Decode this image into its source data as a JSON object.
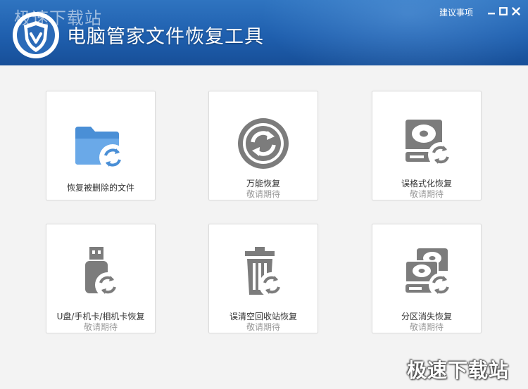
{
  "window": {
    "title": "电脑管家文件恢复工具",
    "watermark_top": "极速下载站",
    "suggestion_link": "建议事项",
    "controls": [
      "minimize-icon",
      "maximize-icon",
      "close-icon"
    ]
  },
  "colors": {
    "titlebar": "#1f5fae",
    "accent_blue": "#4a8fd6",
    "icon_gray": "#7c7c7c",
    "card_bg": "#ffffff",
    "page_bg": "#f3f3f3"
  },
  "tiles": [
    {
      "icon": "folder-restore-icon",
      "label": "恢复被删除的文件",
      "sub": ""
    },
    {
      "icon": "recycle-arrows-icon",
      "label": "万能恢复",
      "sub": "敬请期待"
    },
    {
      "icon": "hard-disk-restore-icon",
      "label": "误格式化恢复",
      "sub": "敬请期待"
    },
    {
      "icon": "usb-drive-restore-icon",
      "label": "U盘/手机卡/相机卡恢复",
      "sub": "敬请期待"
    },
    {
      "icon": "trash-restore-icon",
      "label": "误清空回收站恢复",
      "sub": "敬请期待"
    },
    {
      "icon": "partition-restore-icon",
      "label": "分区消失恢复",
      "sub": "敬请期待"
    }
  ],
  "watermark_bottom": "极速下载站"
}
